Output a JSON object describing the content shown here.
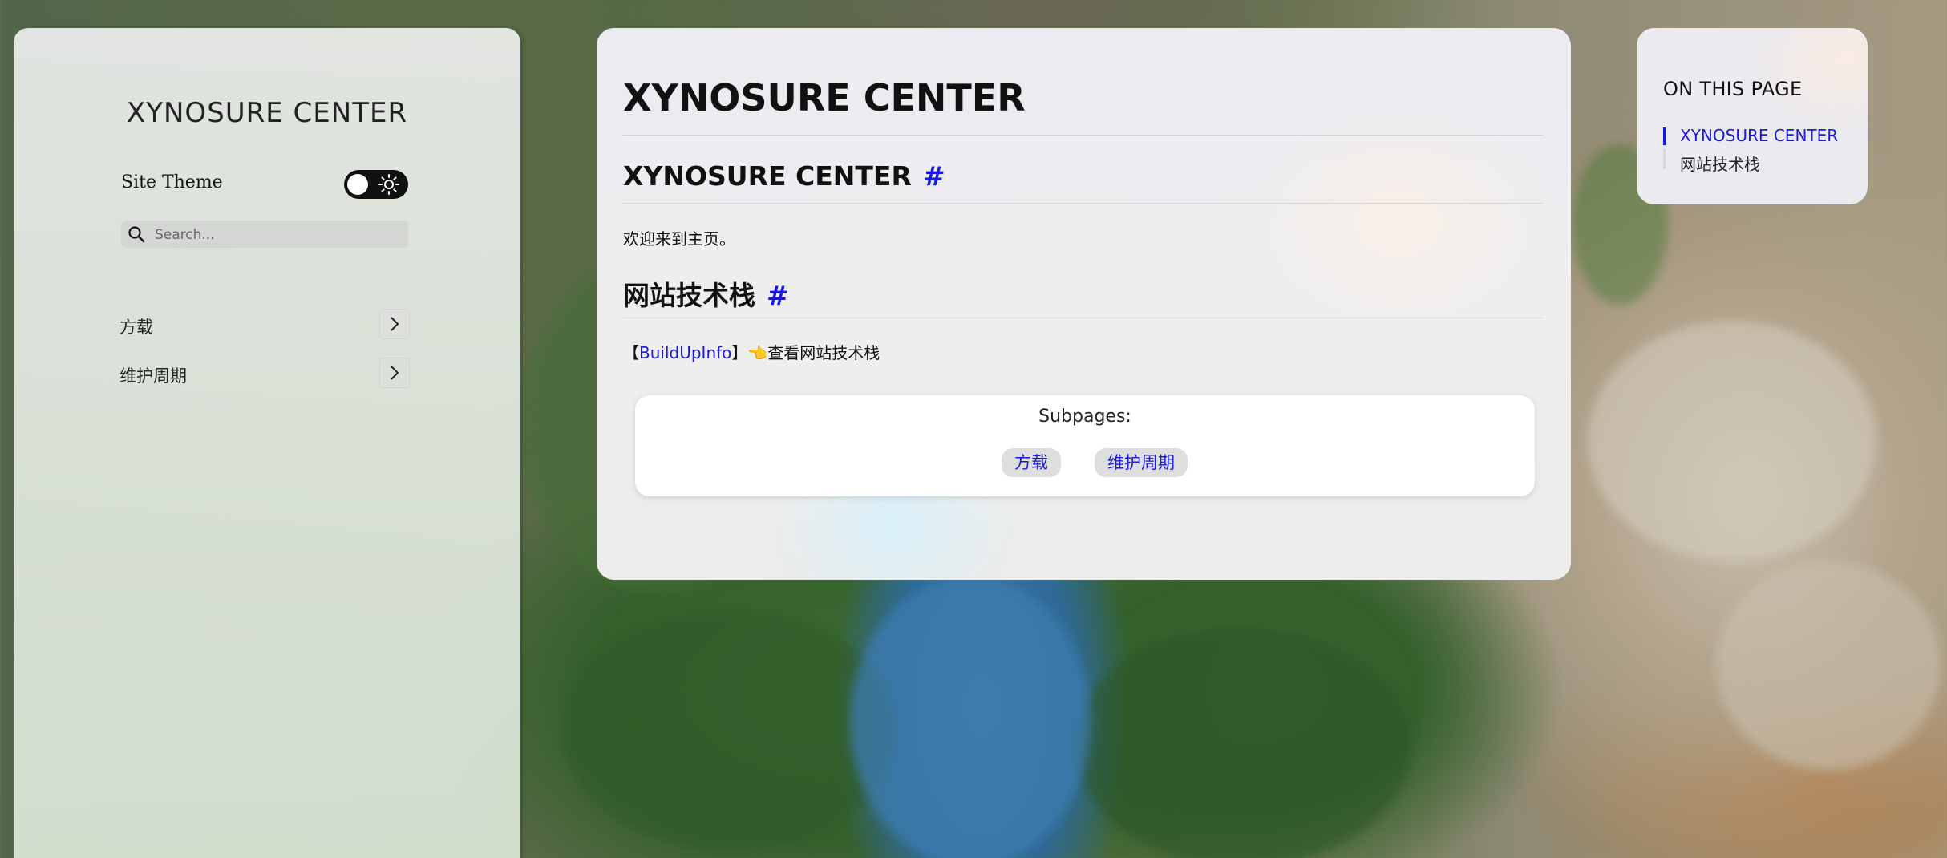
{
  "sidebar": {
    "brand": "XYNOSURE CENTER",
    "theme_label": "Site Theme",
    "search_placeholder": "Search...",
    "nav": [
      {
        "label": "方载"
      },
      {
        "label": "维护周期"
      }
    ]
  },
  "main": {
    "title": "XYNOSURE CENTER",
    "sections": [
      {
        "heading": "XYNOSURE CENTER",
        "anchor": "#",
        "text": "欢迎来到主页。"
      },
      {
        "heading": "网站技术栈",
        "anchor": "#",
        "bracket_open": "【",
        "link": "BuildUpInfo",
        "bracket_close": "】",
        "emoji": "👈",
        "text": "查看网站技术栈"
      }
    ],
    "subpages": {
      "title": "Subpages:",
      "items": [
        "方载",
        "维护周期"
      ]
    }
  },
  "toc": {
    "heading": "ON THIS PAGE",
    "items": [
      "XYNOSURE CENTER",
      "网站技术栈"
    ]
  },
  "colors": {
    "accent": "#1616e6",
    "active_toc": "#1a1ad8"
  }
}
